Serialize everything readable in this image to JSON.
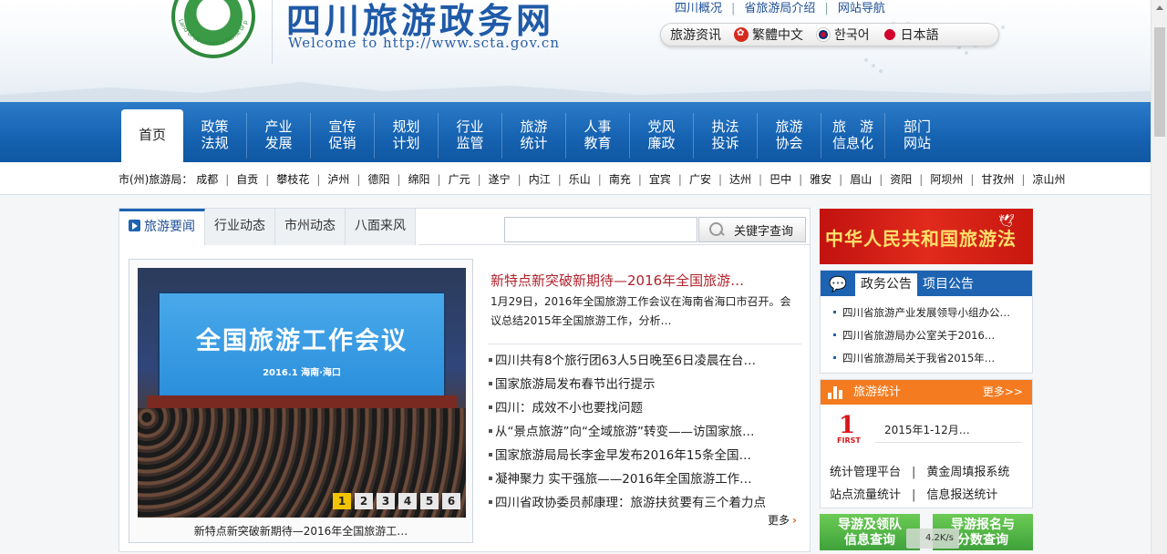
{
  "header": {
    "logo_text": "Land of abundance Home of panda",
    "site_title": "四川旅游政务网",
    "site_subtitle": "Welcome to http://www.scta.gov.cn",
    "top_links": [
      "四川概况",
      "省旅游局介绍",
      "网站导航"
    ],
    "languages": [
      {
        "label": "旅游资讯",
        "flag": "none"
      },
      {
        "label": "繁體中文",
        "flag": "hk"
      },
      {
        "label": "한국어",
        "flag": "kr"
      },
      {
        "label": "日本語",
        "flag": "jp"
      }
    ]
  },
  "nav": {
    "home": "首页",
    "items": [
      {
        "line1": "政策",
        "line2": "法规"
      },
      {
        "line1": "产业",
        "line2": "发展"
      },
      {
        "line1": "宣传",
        "line2": "促销"
      },
      {
        "line1": "规划",
        "line2": "计划"
      },
      {
        "line1": "行业",
        "line2": "监管"
      },
      {
        "line1": "旅游",
        "line2": "统计"
      },
      {
        "line1": "人事",
        "line2": "教育"
      },
      {
        "line1": "党风",
        "line2": "廉政"
      },
      {
        "line1": "执法",
        "line2": "投诉"
      },
      {
        "line1": "旅游",
        "line2": "协会"
      },
      {
        "line1": "旅　游",
        "line2": "信息化"
      },
      {
        "line1": "部门",
        "line2": "网站"
      }
    ]
  },
  "citybar": {
    "label": "市(州)旅游局：",
    "cities": [
      "成都",
      "自贡",
      "攀枝花",
      "泸州",
      "德阳",
      "绵阳",
      "广元",
      "遂宁",
      "内江",
      "乐山",
      "南充",
      "宜宾",
      "广安",
      "达州",
      "巴中",
      "雅安",
      "眉山",
      "资阳",
      "阿坝州",
      "甘孜州",
      "凉山州"
    ]
  },
  "news": {
    "tabs": [
      "旅游要闻",
      "行业动态",
      "市州动态",
      "八面来风"
    ],
    "search_placeholder": "",
    "search_button": "关键字查询",
    "photo": {
      "screen_title": "全国旅游工作会议",
      "screen_sub": "2016.1 海南·海口",
      "caption": "新特点新突破新期待—2016年全国旅游工…",
      "pages": [
        "1",
        "2",
        "3",
        "4",
        "5",
        "6"
      ],
      "active_page": "1"
    },
    "headline": "新特点新突破新期待—2016年全国旅游…",
    "summary": "1月29日，2016年全国旅游工作会议在海南省海口市召开。会议总结2015年全国旅游工作，分析…",
    "items": [
      "四川共有8个旅行团63人5日晚至6日凌晨在台…",
      "国家旅游局发布春节出行提示",
      "四川：成效不小也要找问题",
      "从“景点旅游”向“全域旅游”转变——访国家旅…",
      "国家旅游局局长李金早发布2016年15条全国…",
      "凝神聚力 实干强旅——2016年全国旅游工作…",
      "四川省政协委员郝康理：旅游扶贫要有三个着力点"
    ],
    "more": "更多"
  },
  "sidebar": {
    "law_banner": "中华人民共和国旅游法",
    "notice": {
      "tabs": [
        "政务公告",
        "项目公告"
      ],
      "items": [
        "四川省旅游产业发展领导小组办公…",
        "四川省旅游局办公室关于2016…",
        "四川省旅游局关于我省2015年…"
      ]
    },
    "stats": {
      "title": "旅游统计",
      "more": "更多>>",
      "badge_num": "1",
      "badge_word": "FIRST",
      "date": "2015年1-12月…",
      "links_row1": [
        "统计管理平台",
        "黄金周填报系统"
      ],
      "links_row2": [
        "站点流量统计",
        "信息报送统计"
      ]
    },
    "buttons": [
      {
        "line1": "导游及领队",
        "line2": "信息查询"
      },
      {
        "line1": "导游报名与",
        "line2": "分数查询"
      }
    ],
    "speed_overlay": "4.2K/s"
  },
  "colors": {
    "nav_blue": "#1764b3",
    "headline_red": "#b0212b",
    "stats_orange": "#f47b20",
    "button_green": "#4fb545"
  }
}
